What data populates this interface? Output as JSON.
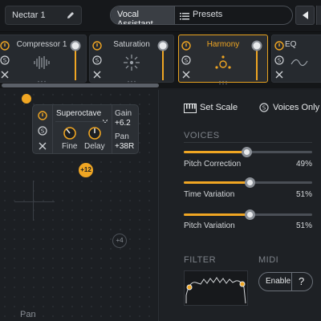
{
  "header": {
    "preset_name": "Nectar 1",
    "vocal_assistant_label": "Vocal Assistant",
    "presets_label": "Presets"
  },
  "modules": [
    {
      "title": "Compressor 1",
      "active": false,
      "icon": "compressor-waveform-icon"
    },
    {
      "title": "Saturation",
      "active": false,
      "icon": "saturation-burst-icon"
    },
    {
      "title": "Harmony",
      "active": true,
      "icon": "harmony-voices-icon"
    },
    {
      "title": "EQ",
      "active": false,
      "icon": "eq-icon"
    }
  ],
  "voice_card": {
    "type": "Superoctave",
    "fine_label": "Fine",
    "delay_label": "Delay",
    "gain_label": "Gain",
    "gain_value": "+6.2",
    "pan_label": "Pan",
    "pan_value": "+38R"
  },
  "field": {
    "voice_badge": "+12",
    "ghost_badge": "+4",
    "axis_label": "Pan"
  },
  "panel": {
    "set_scale": "Set Scale",
    "voices_only": "Voices Only",
    "voices_header": "VOICES",
    "sliders": [
      {
        "label": "Pitch Correction",
        "value": "49%",
        "level": 0.49
      },
      {
        "label": "Time Variation",
        "value": "51%",
        "level": 0.51
      },
      {
        "label": "Pitch Variation",
        "value": "51%",
        "level": 0.51
      }
    ],
    "filter_header": "FILTER",
    "midi_header": "MIDI",
    "enable_label": "Enable",
    "help_label": "?"
  },
  "colors": {
    "accent": "#f0a623",
    "background": "#1c1f23"
  }
}
